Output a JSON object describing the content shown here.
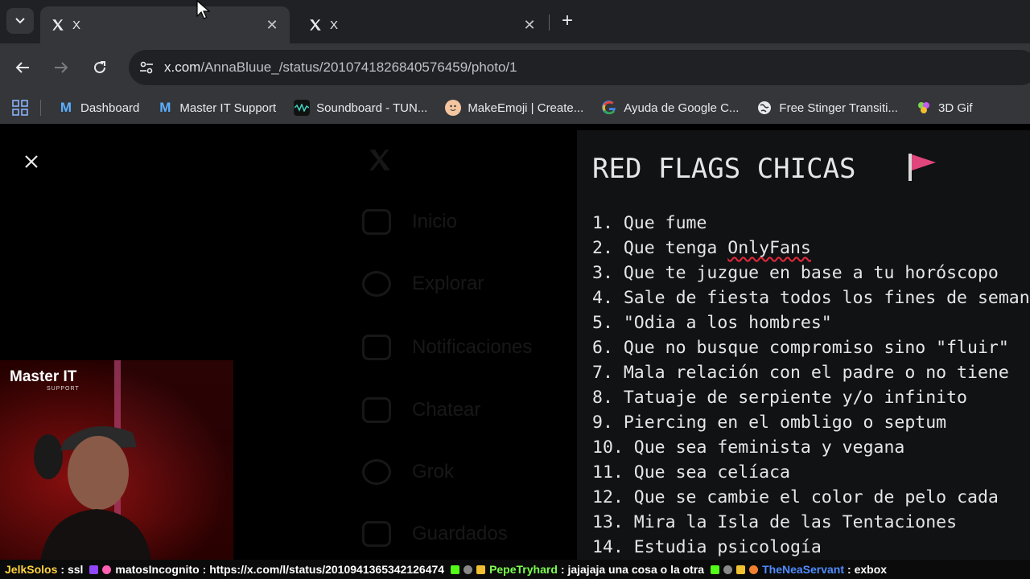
{
  "browser": {
    "tabs": [
      {
        "title": "X",
        "active": true
      },
      {
        "title": "X",
        "active": false
      }
    ],
    "url_host": "x.com",
    "url_path": "/AnnaBluue_/status/2010741826840576459/photo/1",
    "bookmarks": [
      {
        "label": "Dashboard",
        "icon": "master-it-icon"
      },
      {
        "label": "Master IT Support",
        "icon": "master-it-icon"
      },
      {
        "label": "Soundboard - TUN...",
        "icon": "soundboard-icon"
      },
      {
        "label": "MakeEmoji | Create...",
        "icon": "makeemoji-icon"
      },
      {
        "label": "Ayuda de Google C...",
        "icon": "google-icon"
      },
      {
        "label": "Free Stinger Transiti...",
        "icon": "globe-icon"
      },
      {
        "label": "3D Gif",
        "icon": "3d-gif-icon"
      }
    ]
  },
  "sidebar_ghost": {
    "items": [
      "Inicio",
      "Explorar",
      "Notificaciones",
      "Chatear",
      "Grok",
      "Guardados"
    ]
  },
  "photo": {
    "title": "RED FLAGS CHICAS",
    "items": [
      {
        "n": "1.",
        "text": "Que fume"
      },
      {
        "n": "2.",
        "text": "Que tenga ",
        "underlined": "OnlyFans"
      },
      {
        "n": "3.",
        "text": "Que te juzgue en base a tu horóscopo"
      },
      {
        "n": "4.",
        "text": "Sale de fiesta todos los fines de semana"
      },
      {
        "n": "5.",
        "text": "\"Odia a los hombres\""
      },
      {
        "n": "6.",
        "text": "Que no busque compromiso sino \"fluir\""
      },
      {
        "n": "7.",
        "text": "Mala relación con el padre o no tiene"
      },
      {
        "n": "8.",
        "text": "Tatuaje de serpiente y/o infinito"
      },
      {
        "n": "9.",
        "text": "Piercing en el ombligo o septum"
      },
      {
        "n": "10.",
        "text": "Que sea feminista y vegana"
      },
      {
        "n": "11.",
        "text": "Que sea celíaca"
      },
      {
        "n": "12.",
        "text": "Que se cambie el color de pelo cada"
      },
      {
        "n": "13.",
        "text": "Mira la Isla de las Tentaciones"
      },
      {
        "n": "14.",
        "text": "Estudia psicología"
      }
    ]
  },
  "webcam": {
    "logo_main": "Master IT",
    "logo_sub": "SUPPORT"
  },
  "chat": [
    {
      "user": "JelkSolos",
      "message": "ssl",
      "color": "#ffd23f"
    },
    {
      "user": "matosIncognito",
      "message": "https://x.com/l/status/2010941365342126474",
      "color": "#ffffff"
    },
    {
      "user": "PepeTryhard",
      "message": "jajajaja una cosa o la otra",
      "color": "#7cff4f"
    },
    {
      "user": "TheNeaServant",
      "message": "exbox",
      "color": "#4f8cff"
    }
  ],
  "colors": {
    "tab_bg": "#202124",
    "toolbar_bg": "#35363a",
    "flag_pink": "#e0467c"
  }
}
